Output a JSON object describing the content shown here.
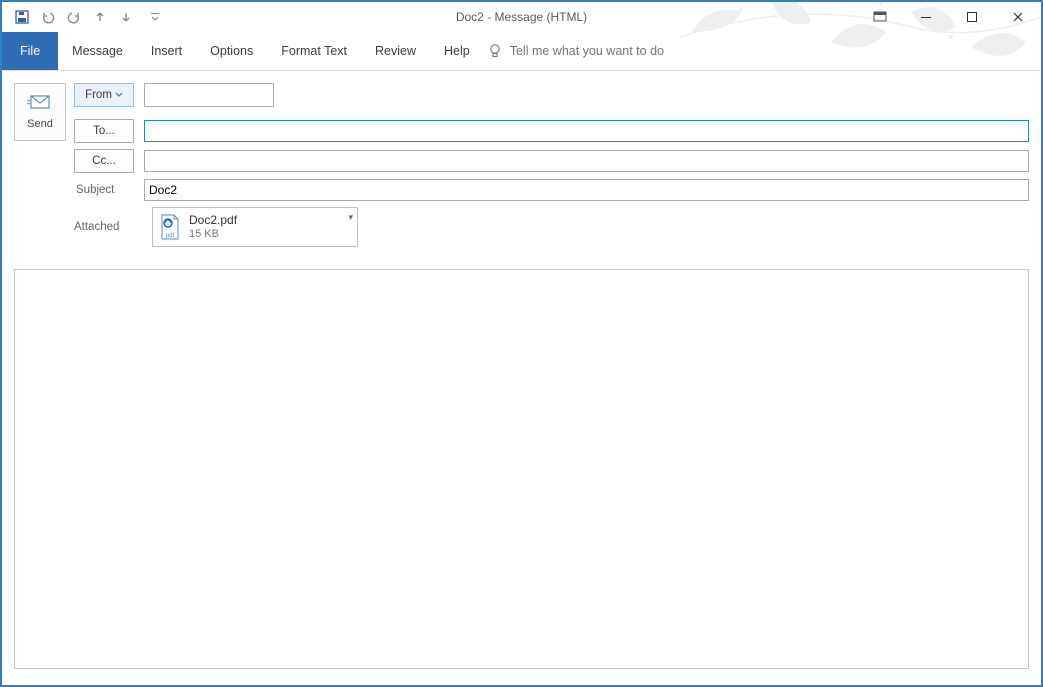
{
  "window_title": "Doc2  -  Message (HTML)",
  "qat": {
    "save": "save-icon",
    "undo": "undo-icon",
    "redo": "redo-icon",
    "prev": "previous-item-icon",
    "next": "next-item-icon",
    "customize": "customize-qat-icon"
  },
  "wincontrols": {
    "ribbon_options": "ribbon-display-options-icon",
    "minimize": "minimize-icon",
    "maximize": "maximize-icon",
    "close": "close-icon"
  },
  "ribbon": {
    "file": "File",
    "tabs": [
      "Message",
      "Insert",
      "Options",
      "Format Text",
      "Review",
      "Help"
    ],
    "tellme_placeholder": "Tell me what you want to do"
  },
  "send": {
    "label": "Send"
  },
  "header": {
    "from_label": "From",
    "to_label": "To...",
    "cc_label": "Cc...",
    "subject_label": "Subject",
    "attached_label": "Attached",
    "from_value": "",
    "to_value": "",
    "cc_value": "",
    "subject_value": "Doc2"
  },
  "attachment": {
    "name": "Doc2.pdf",
    "size": "15 KB"
  },
  "body_text": ""
}
